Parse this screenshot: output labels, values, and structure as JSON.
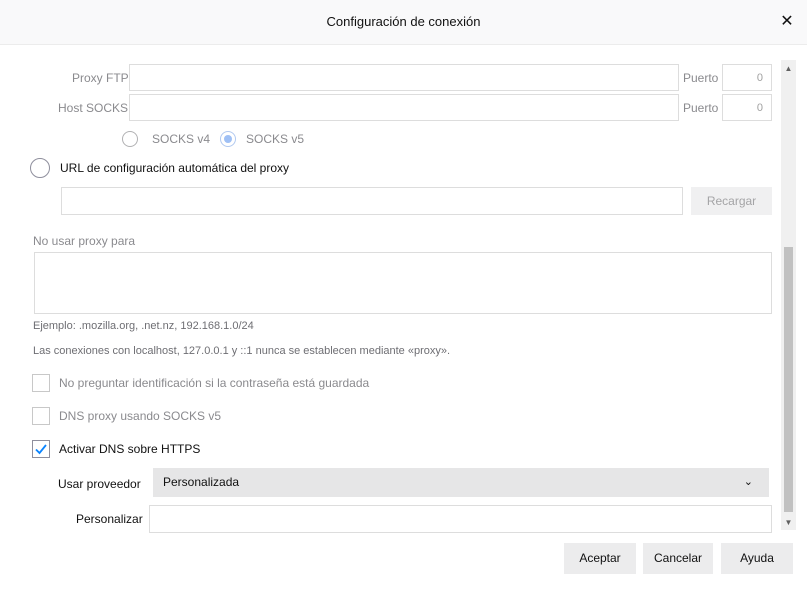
{
  "dialog": {
    "title": "Configuración de conexión",
    "close_glyph": "✕"
  },
  "proxy": {
    "ftp_label": "Proxy FTP",
    "socks_label": "Host SOCKS",
    "port_label": "Puerto",
    "ftp_port": "0",
    "socks_port": "0",
    "socks_v4": "SOCKS v4",
    "socks_v5": "SOCKS v5",
    "socks_selected": "SOCKS v5"
  },
  "auto": {
    "label": "URL de configuración automática del proxy",
    "url_value": "",
    "reload_label": "Recargar"
  },
  "no_proxy": {
    "label": "No usar proxy para",
    "value": "",
    "example": "Ejemplo: .mozilla.org, .net.nz, 192.168.1.0/24",
    "note": "Las conexiones con localhost, 127.0.0.1 y ::1 nunca se establecen mediante «proxy»."
  },
  "options": {
    "no_auth_prompt": "No preguntar identificación si la contraseña está guardada",
    "no_auth_checked": false,
    "socks_dns": "DNS proxy usando SOCKS v5",
    "socks_dns_checked": false,
    "doh": "Activar DNS sobre HTTPS",
    "doh_checked": true
  },
  "provider": {
    "label": "Usar proveedor",
    "selected": "Personalizada",
    "custom_label": "Personalizar",
    "custom_value": ""
  },
  "footer": {
    "ok": "Aceptar",
    "cancel": "Cancelar",
    "help": "Ayuda"
  },
  "colors": {
    "accent": "#0a84ff",
    "radio_selected": "#9fc0f5"
  }
}
